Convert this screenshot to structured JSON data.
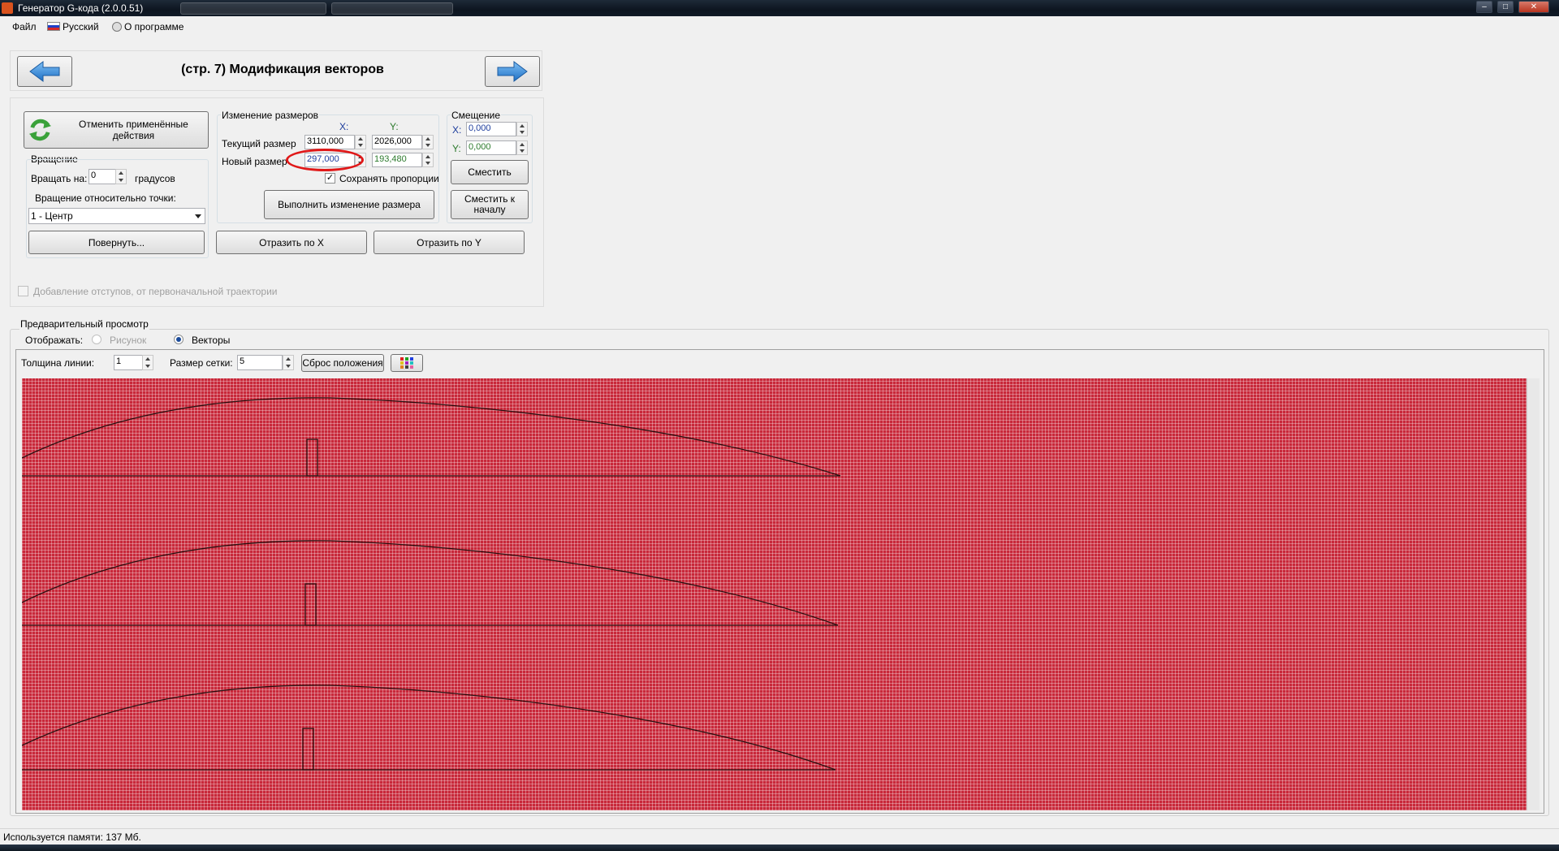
{
  "window": {
    "title": "Генератор G-кода (2.0.0.51)",
    "controls": {
      "minimize": "–",
      "maximize": "□",
      "close": "✕"
    }
  },
  "menu": {
    "file": "Файл",
    "language": "Русский",
    "about": "О программе"
  },
  "header": {
    "page_title": "(стр. 7) Модификация векторов",
    "back_icon": "arrow-left-icon",
    "next_icon": "arrow-right-icon"
  },
  "actions": {
    "undo_label": "Отменить применённые действия",
    "undo_icon": "refresh-icon"
  },
  "rotation": {
    "group_label": "Вращение",
    "rotate_by_label": "Вращать на:",
    "rotate_value": "0",
    "degrees_label": "градусов",
    "pivot_label": "Вращение относительно точки:",
    "pivot_value": "1 - Центр",
    "rotate_button": "Повернуть..."
  },
  "resize": {
    "group_label": "Изменение размеров",
    "x_header": "X:",
    "y_header": "Y:",
    "current_label": "Текущий размер",
    "current_x": "3110,000",
    "current_y": "2026,000",
    "new_label": "Новый размер",
    "new_x": "297,000",
    "new_y": "193,480",
    "keep_ratio_label": "Сохранять пропорции",
    "keep_ratio_checked": true,
    "apply_button": "Выполнить изменение размера"
  },
  "offset": {
    "group_label": "Смещение",
    "x_label": "X:",
    "x_value": "0,000",
    "y_label": "Y:",
    "y_value": "0,000",
    "shift_button": "Сместить",
    "shift_origin_button": "Сместить к началу"
  },
  "mirror": {
    "mirror_x_button": "Отразить по X",
    "mirror_y_button": "Отразить по Y"
  },
  "offsets_checkbox_label": "Добавление отступов, от первоначальной траектории",
  "preview": {
    "group_label": "Предварительный просмотр",
    "display_label": "Отображать:",
    "option_picture": "Рисунок",
    "option_vectors": "Векторы",
    "selected_option": "Векторы",
    "line_width_label": "Толщина линии:",
    "line_width_value": "1",
    "grid_size_label": "Размер сетки:",
    "grid_size_value": "5",
    "reset_position_button": "Сброс положения",
    "palette_icon": "palette-icon",
    "grid_color": "#c8283a"
  },
  "status": {
    "memory_text": "Используется памяти:  137  Мб."
  }
}
